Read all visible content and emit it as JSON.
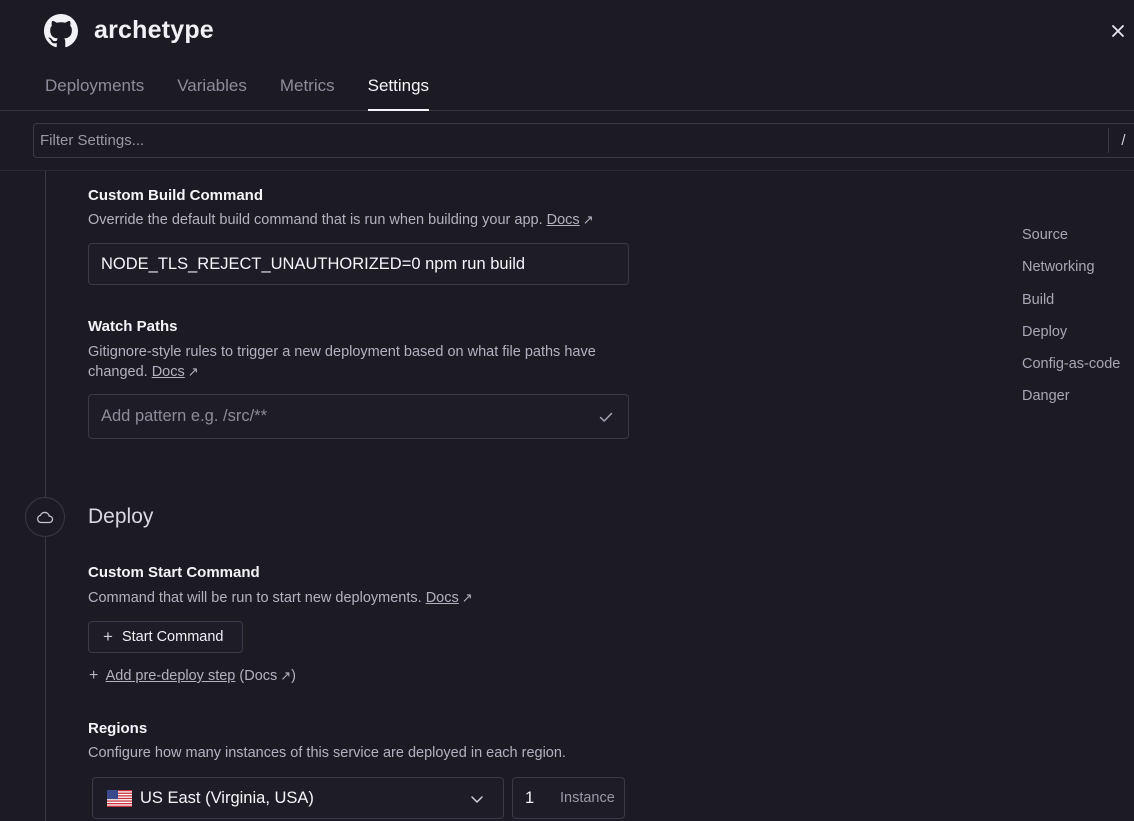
{
  "header": {
    "app_title": "archetype",
    "logo_icon": "github-icon",
    "close_symbol": "×"
  },
  "tabs": [
    {
      "label": "Deployments",
      "active": false
    },
    {
      "label": "Variables",
      "active": false
    },
    {
      "label": "Metrics",
      "active": false
    },
    {
      "label": "Settings",
      "active": true
    }
  ],
  "filter": {
    "placeholder": "Filter Settings...",
    "shortcut": "/"
  },
  "build": {
    "custom_build": {
      "title": "Custom Build Command",
      "description": "Override the default build command that is run when building your app.",
      "docs_label": "Docs",
      "value": "NODE_TLS_REJECT_UNAUTHORIZED=0 npm run build"
    },
    "watch_paths": {
      "title": "Watch Paths",
      "description": "Gitignore-style rules to trigger a new deployment based on what file paths have changed.",
      "docs_label": "Docs",
      "placeholder": "Add pattern e.g. /src/**"
    }
  },
  "deploy": {
    "section_title": "Deploy",
    "section_icon": "cloud-icon",
    "start_command": {
      "title": "Custom Start Command",
      "description": "Command that will be run to start new deployments.",
      "docs_label": "Docs",
      "button_label": "Start Command"
    },
    "pre_deploy": {
      "link_label": "Add pre-deploy step",
      "docs_prefix": "(Docs",
      "docs_suffix": ")"
    },
    "regions": {
      "title": "Regions",
      "description": "Configure how many instances of this service are deployed in each region.",
      "selected_region": "US East (Virginia, USA)",
      "flag_icon": "us-flag-icon",
      "instance_count": "1",
      "instance_label": "Instance"
    }
  },
  "toc": [
    "Source",
    "Networking",
    "Build",
    "Deploy",
    "Config-as-code",
    "Danger"
  ],
  "colors": {
    "background": "#1c1b24",
    "border": "#3b3946",
    "text": "#e9e8ef",
    "muted": "#b4b2c0"
  }
}
